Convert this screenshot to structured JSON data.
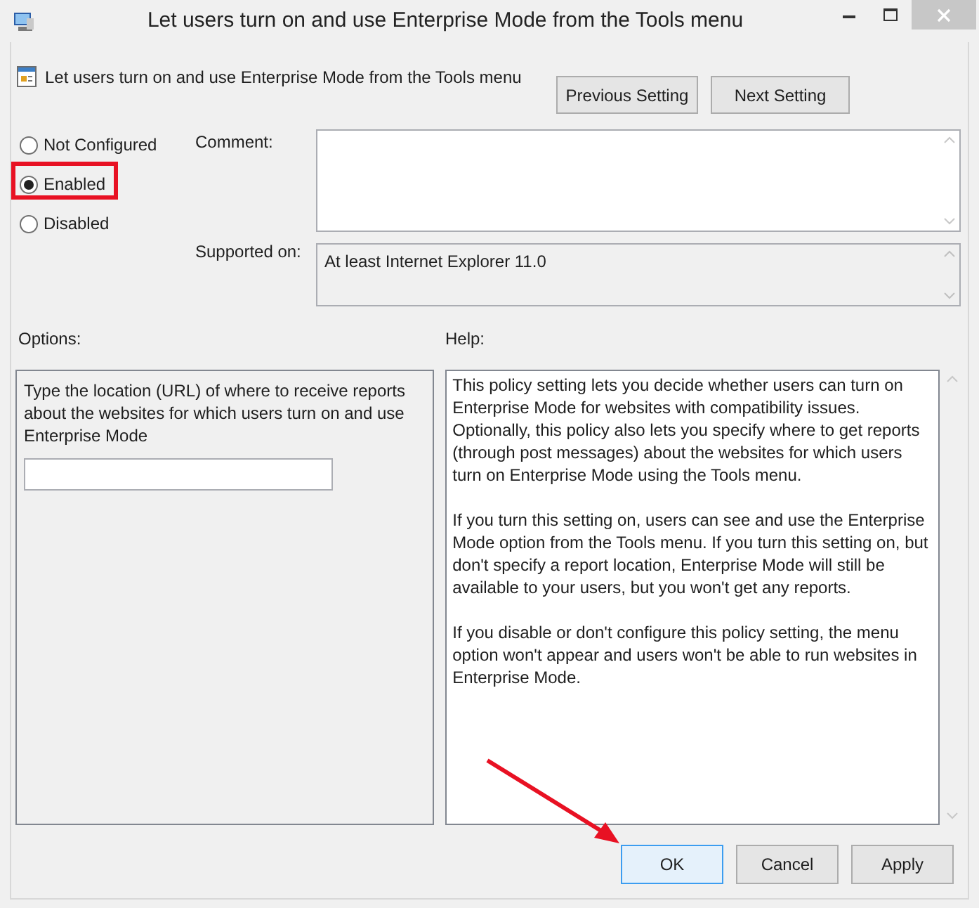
{
  "window": {
    "title": "Let users turn on and use Enterprise Mode from the Tools menu"
  },
  "policy": {
    "name": "Let users turn on and use Enterprise Mode from the Tools menu"
  },
  "nav_buttons": [
    "Previous Setting",
    "Next Setting"
  ],
  "states": [
    {
      "label": "Not Configured",
      "selected": false,
      "highlighted": false
    },
    {
      "label": "Enabled",
      "selected": true,
      "highlighted": true
    },
    {
      "label": "Disabled",
      "selected": false,
      "highlighted": false
    }
  ],
  "comment": {
    "label": "Comment:"
  },
  "supported_on": {
    "label": "Supported on:",
    "value": "At least Internet Explorer 11.0"
  },
  "options": {
    "label": "Options:",
    "description": "Type the location (URL) of where to receive reports about the websites for which users turn on and use Enterprise Mode"
  },
  "help": {
    "label": "Help:",
    "paragraphs": [
      "This policy setting lets you decide whether users can turn on Enterprise Mode for websites with compatibility issues. Optionally, this policy also lets you specify where to get reports (through post messages) about the websites for which users turn on Enterprise Mode using the Tools menu.",
      "If you turn this setting on, users can see and use the Enterprise Mode option from the Tools menu. If you turn this setting on, but don't specify a report location, Enterprise Mode will still be available to your users, but you won't get any reports.",
      "If you disable or don't configure this policy setting, the menu option won't appear and users won't be able to run websites in Enterprise Mode."
    ]
  },
  "buttons": [
    {
      "label": "OK",
      "focused": true,
      "arrow_pointing": true
    },
    {
      "label": "Cancel",
      "focused": false,
      "arrow_pointing": false
    },
    {
      "label": "Apply",
      "focused": false,
      "arrow_pointing": false
    }
  ]
}
